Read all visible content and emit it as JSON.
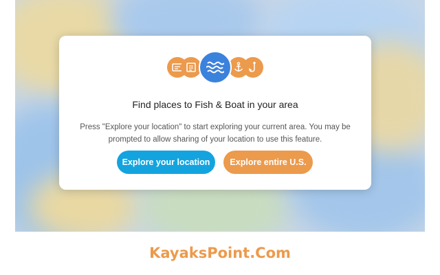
{
  "dialog": {
    "icons": [
      "fishing-license-icon",
      "boat-registration-icon",
      "waves-icon",
      "anchor-icon",
      "fish-hook-icon"
    ],
    "title": "Find places to Fish & Boat in your area",
    "description": "Press \"Explore your location\" to start exploring your current area. You may be prompted to allow sharing of your location to use this feature.",
    "primary_button": "Explore your location",
    "secondary_button": "Explore entire U.S."
  },
  "watermark": "KayaksPoint.Com",
  "colors": {
    "orange": "#ec9a4c",
    "blue_button": "#13a4df",
    "waves_blue": "#3b82dc"
  }
}
